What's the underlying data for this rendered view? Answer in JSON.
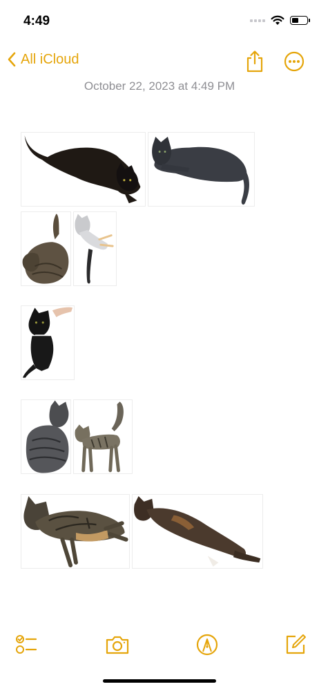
{
  "status_bar": {
    "time": "4:49",
    "signal_icon": "cellular-signal-icon",
    "wifi_icon": "wifi-icon",
    "battery_icon": "battery-icon",
    "battery_level": 0.45
  },
  "nav": {
    "back_label": "All iCloud",
    "back_icon": "chevron-left-icon",
    "share_icon": "share-icon",
    "more_icon": "ellipsis-circle-icon"
  },
  "note": {
    "date": "October 22, 2023 at 4:49 PM"
  },
  "toolbar": {
    "checklist_icon": "checklist-icon",
    "camera_icon": "camera-icon",
    "markup_icon": "pen-tip-icon",
    "compose_icon": "compose-icon"
  },
  "colors": {
    "accent": "#e5a50a",
    "date_text": "#8e8e93",
    "background": "#ffffff"
  }
}
